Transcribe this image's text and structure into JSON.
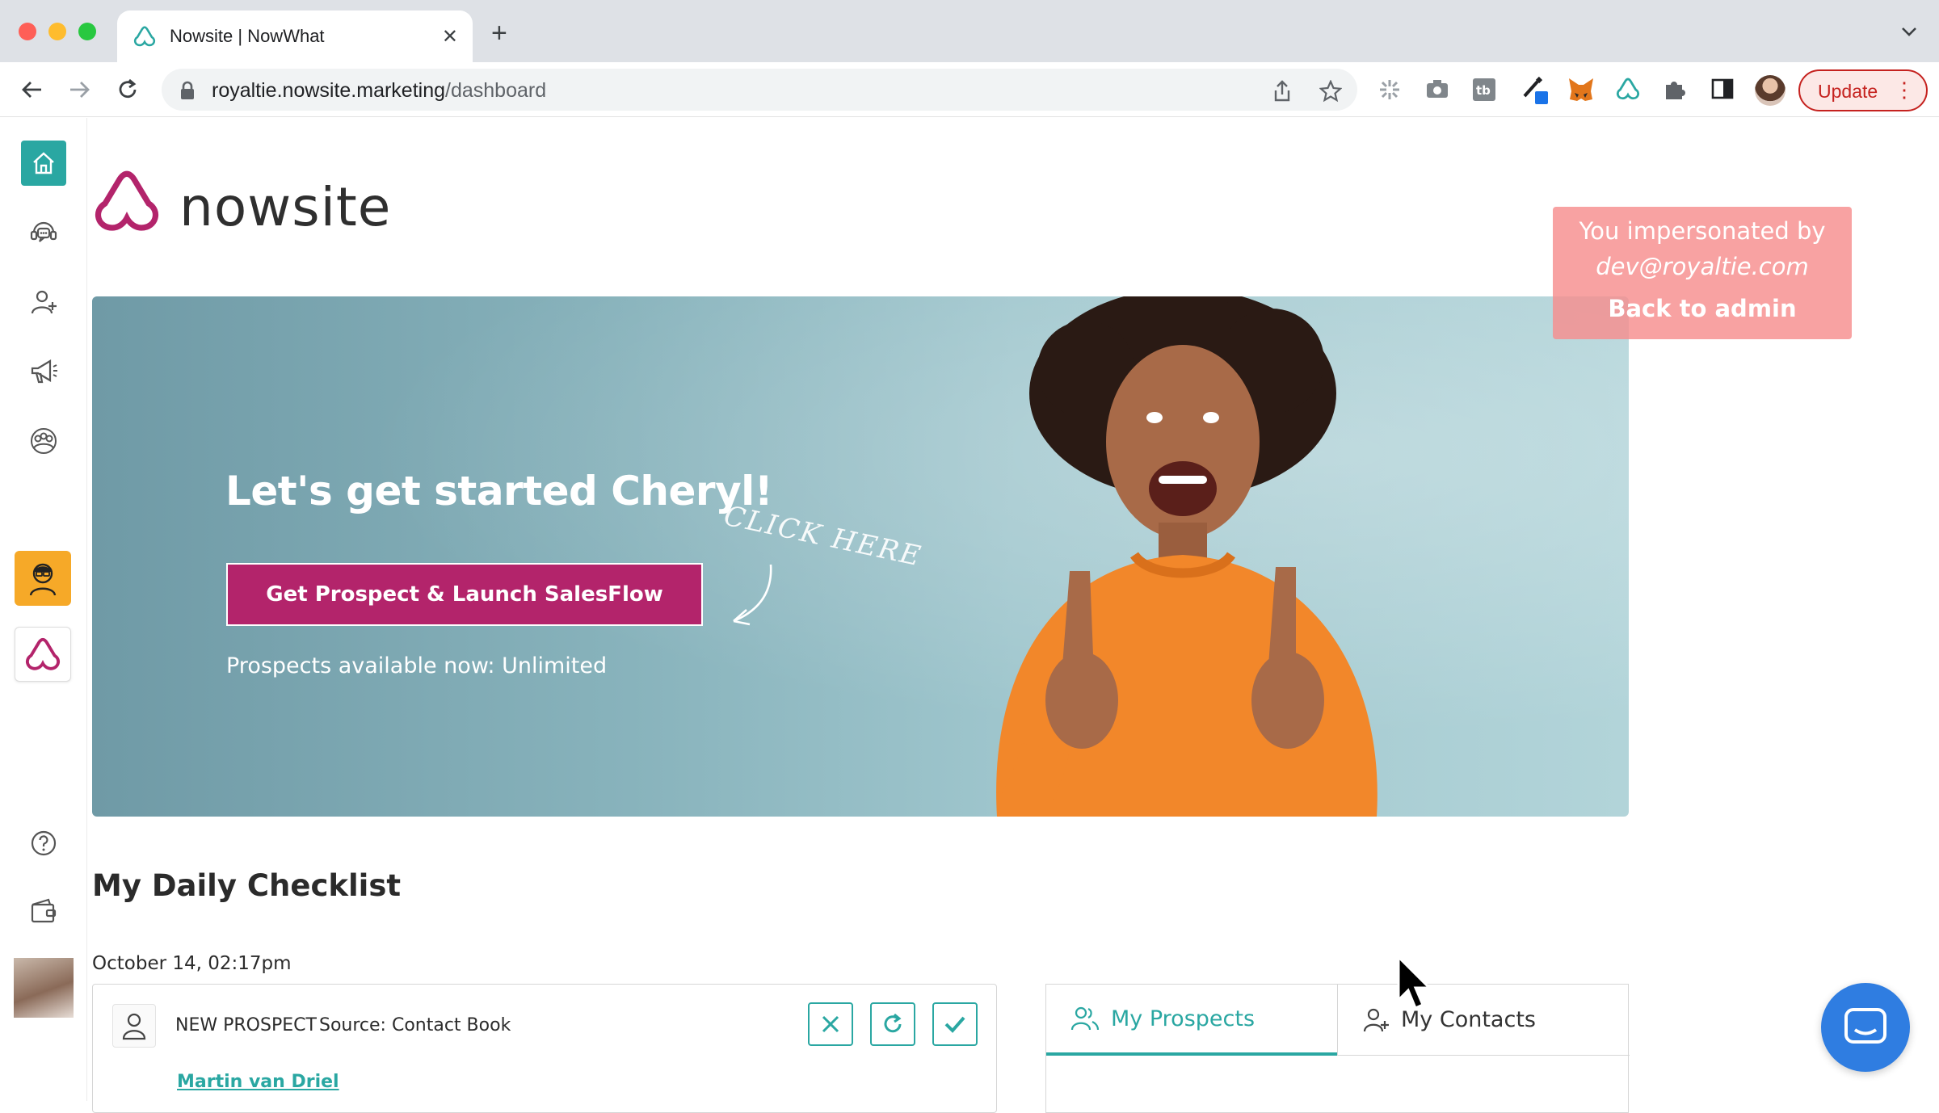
{
  "browser": {
    "tab_title": "Nowsite | NowWhat",
    "new_tab": "+",
    "url_domain": "royaltie.nowsite.marketing",
    "url_path": "/dashboard",
    "update_label": "Update",
    "menu_glyph": "⋮"
  },
  "rail": {
    "items": [
      {
        "icon": "home-icon"
      },
      {
        "icon": "support-chat-icon"
      },
      {
        "icon": "add-user-icon"
      },
      {
        "icon": "megaphone-icon"
      },
      {
        "icon": "group-icon"
      },
      {
        "icon": "agent-avatar-icon"
      },
      {
        "icon": "nowsite-logo-icon"
      },
      {
        "icon": "help-icon"
      },
      {
        "icon": "wallet-icon"
      },
      {
        "icon": "user-avatar"
      }
    ],
    "accent": "#2aa7a2"
  },
  "brand": {
    "name": "nowsite",
    "color": "#b3246b"
  },
  "hero": {
    "title": "Let's get started Cheryl!",
    "button": "Get Prospect & Launch SalesFlow",
    "note": "Prospects available now: Unlimited",
    "annotation": "CLICK HERE"
  },
  "impersonation": {
    "line1": "You impersonated by",
    "email": "dev@royaltie.com",
    "back": "Back to admin"
  },
  "checklist": {
    "title": "My Daily Checklist",
    "date": "October 14, 02:17pm",
    "item": {
      "type": "NEW PROSPECT",
      "source": "Source: Contact Book",
      "name": "Martin van Driel"
    }
  },
  "tabs": {
    "prospects": "My Prospects",
    "contacts": "My Contacts"
  }
}
